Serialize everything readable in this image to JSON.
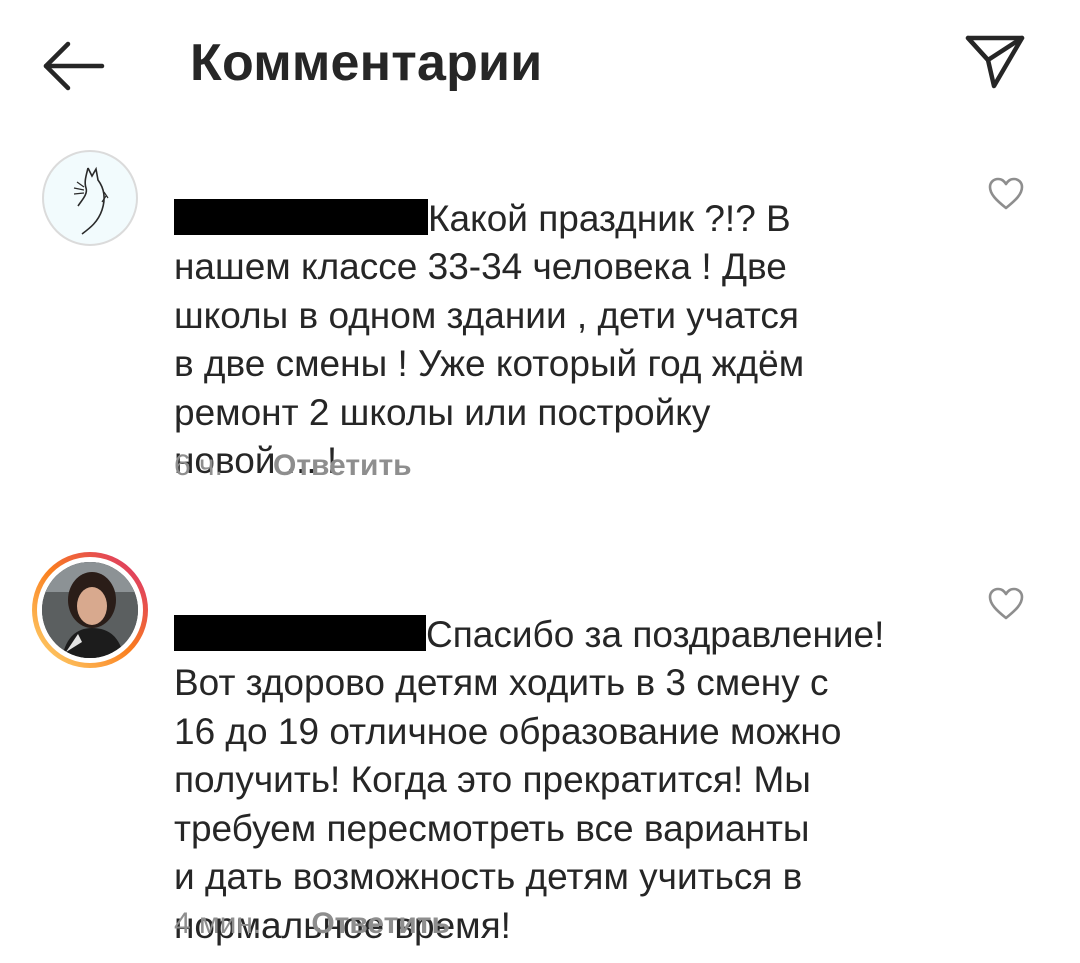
{
  "header": {
    "title": "Комментарии",
    "back_icon": "arrow-left-icon",
    "share_icon": "paper-plane-icon"
  },
  "comments": [
    {
      "avatar_icon": "cat-line-art-avatar",
      "username_redacted": true,
      "text": "Какой праздник ?!? В\nнашем классе 33-34 человека ! Две\nшколы в одном здании , дети учатся\nв две смены ! Уже который год ждём\nремонт 2 школы или постройку\nновой ... !",
      "time": "6 ч.",
      "reply_label": "Ответить",
      "like_icon": "heart-outline-icon"
    },
    {
      "avatar_icon": "woman-photo-avatar",
      "username_redacted": true,
      "text": "Спасибо за поздравление!\nВот здорово детям ходить в 3 смену с\n16 до 19 отличное образование можно\nполучить! Когда это прекратится! Мы\nтребуем пересмотреть все варианты\nи дать возможность детям учиться в\nнормальное время!",
      "time": "4 мин.",
      "reply_label": "Ответить",
      "like_icon": "heart-outline-icon"
    }
  ],
  "colors": {
    "text": "#262626",
    "secondary": "#8e8e8e",
    "story_ring_start": "#feda75",
    "story_ring_end": "#d62976"
  }
}
